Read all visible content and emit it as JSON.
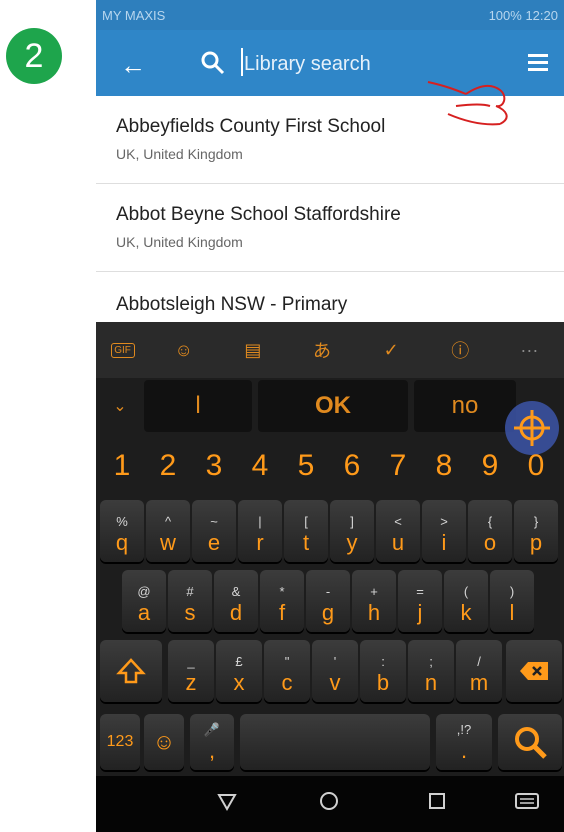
{
  "step": "2",
  "status": {
    "carrier": "MY MAXIS",
    "indicators": "100%",
    "time": "12:20"
  },
  "search": {
    "placeholder": "Library search"
  },
  "icons": {
    "back": "arrow-left-icon",
    "search": "search-icon",
    "menu": "hamburger-menu-icon",
    "pointer": "hand-pointer-icon"
  },
  "results": [
    {
      "title": "Abbeyfields County First School",
      "subtitle": "UK, United Kingdom"
    },
    {
      "title": "Abbot Beyne School Staffordshire",
      "subtitle": "UK, United Kingdom"
    },
    {
      "title": "Abbotsleigh NSW - Primary",
      "subtitle": ""
    }
  ],
  "keyboard": {
    "toolbar": [
      "GIF",
      "sticker",
      "clipboard",
      "translate",
      "check",
      "info",
      "more"
    ],
    "suggestions": [
      "l",
      "OK",
      "no"
    ],
    "numbers": [
      "1",
      "2",
      "3",
      "4",
      "5",
      "6",
      "7",
      "8",
      "9",
      "0"
    ],
    "row1": [
      [
        "%",
        "q"
      ],
      [
        "^",
        "w"
      ],
      [
        "~",
        "e"
      ],
      [
        "|",
        "r"
      ],
      [
        "[",
        "t"
      ],
      [
        "]",
        "y"
      ],
      [
        "<",
        "u"
      ],
      [
        ">",
        "i"
      ],
      [
        "{",
        "o"
      ],
      [
        "}",
        "p"
      ]
    ],
    "row2": [
      [
        "@",
        "a"
      ],
      [
        "#",
        "s"
      ],
      [
        "&",
        "d"
      ],
      [
        "*",
        "f"
      ],
      [
        "-",
        "g"
      ],
      [
        "+",
        "h"
      ],
      [
        "=",
        "j"
      ],
      [
        "(",
        "k"
      ],
      [
        ")",
        "l"
      ]
    ],
    "row3": [
      [
        "_",
        "z"
      ],
      [
        "£",
        "x"
      ],
      [
        "\"",
        "c"
      ],
      [
        "'",
        "v"
      ],
      [
        ":",
        "b"
      ],
      [
        ";",
        "n"
      ],
      [
        "/",
        "m"
      ]
    ],
    "mode_label": "123",
    "period_alt": ",!?",
    "period": ".",
    "comma": ","
  },
  "accent_color": "#2f86c8",
  "key_color": "#ff9a1a"
}
